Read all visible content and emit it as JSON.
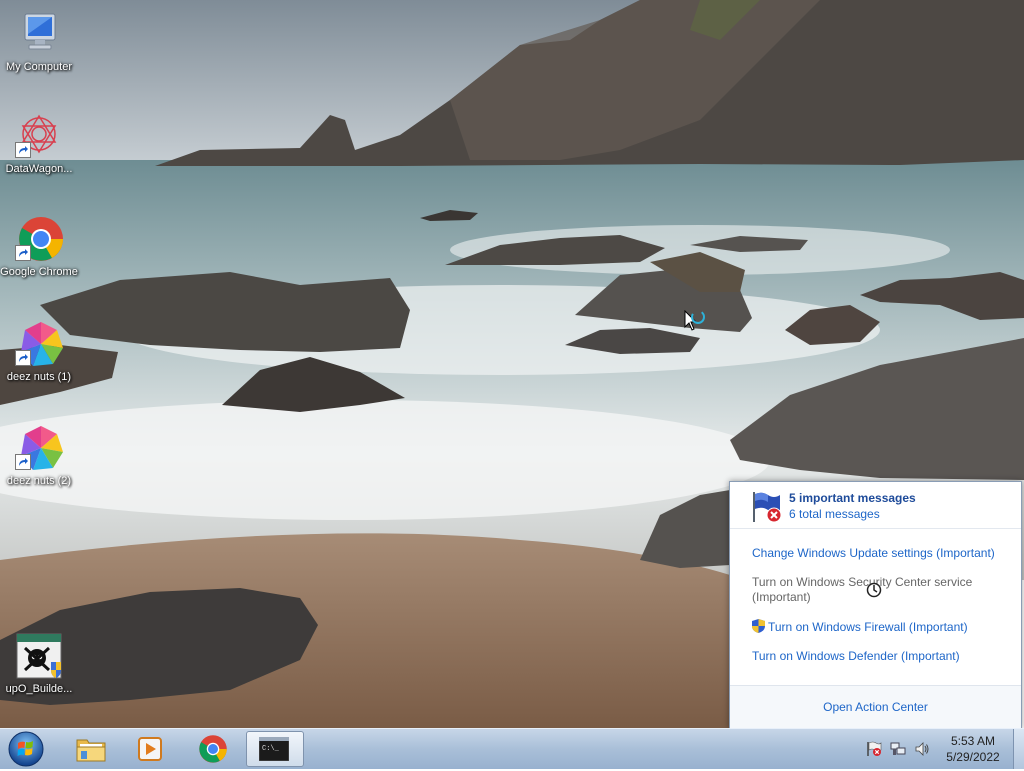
{
  "desktop": {
    "icons": [
      {
        "label": "My Computer",
        "icon": "computer-icon"
      },
      {
        "label": "DataWagon...",
        "icon": "datawagon-icon"
      },
      {
        "label": "Google Chrome",
        "icon": "chrome-icon"
      },
      {
        "label": "deez nuts (1)",
        "icon": "pinwheel-icon"
      },
      {
        "label": "deez nuts (2)",
        "icon": "pinwheel-icon"
      },
      {
        "label": "upO_Builde...",
        "icon": "skull-shield-icon"
      }
    ]
  },
  "action_center": {
    "important": "5 important messages",
    "total": "6 total messages",
    "items": [
      {
        "label": "Change Windows Update settings (Important)",
        "enabled": true
      },
      {
        "label": "Turn on Windows Security Center service (Important)",
        "enabled": false
      },
      {
        "label": "Turn on Windows Firewall (Important)",
        "enabled": true,
        "icon": "uac-shield-icon"
      },
      {
        "label": "Turn on Windows Defender (Important)",
        "enabled": true
      }
    ],
    "open_label": "Open Action Center"
  },
  "taskbar": {
    "pinned": [
      {
        "name": "file-explorer",
        "icon": "folder-icon"
      },
      {
        "name": "media-player",
        "icon": "media-player-icon"
      },
      {
        "name": "chrome",
        "icon": "chrome-icon"
      },
      {
        "name": "command-prompt",
        "icon": "cmd-icon",
        "active": true
      }
    ],
    "tray": {
      "icons": [
        "action-center-flag-icon",
        "network-icon",
        "volume-icon"
      ],
      "time": "5:53 AM",
      "date": "5/29/2022"
    }
  },
  "colors": {
    "link": "#1e66c8",
    "heading_link": "#1e4b9a",
    "taskbar": "#a9bfd8"
  }
}
